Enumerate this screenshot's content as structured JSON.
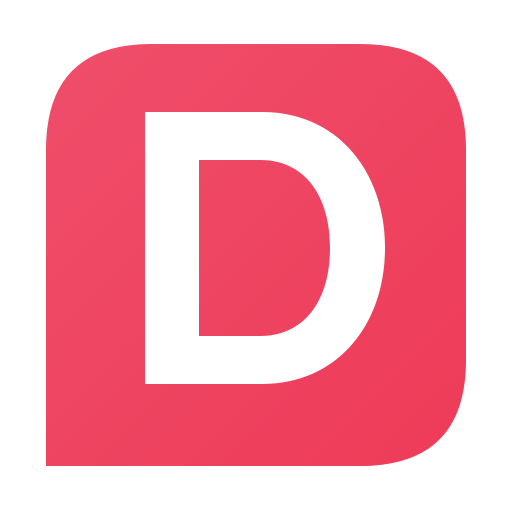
{
  "logo": {
    "letter": "D",
    "background_color_start": "#ef4e6b",
    "background_color_end": "#ee3b58",
    "letter_color": "#ffffff"
  }
}
